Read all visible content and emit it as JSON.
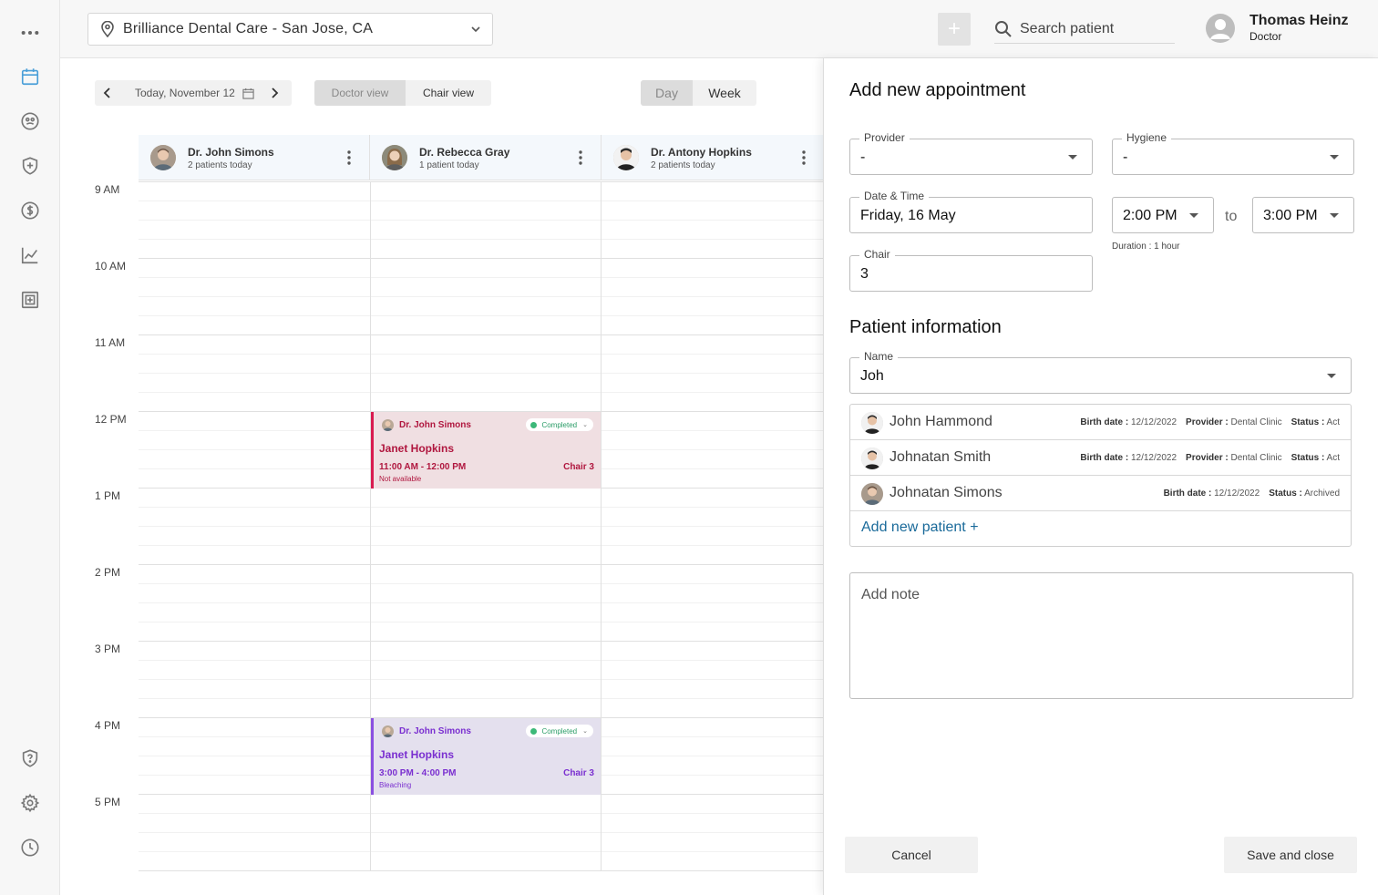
{
  "topbar": {
    "location": "Brilliance Dental Care - San Jose, CA",
    "search_placeholder": "Search patient",
    "user_name": "Thomas Heinz",
    "user_role": "Doctor"
  },
  "toolbar": {
    "date_label": "Today, November 12",
    "doctor_view": "Doctor view",
    "chair_view": "Chair view",
    "day": "Day",
    "week": "Week"
  },
  "providers": [
    {
      "name": "Dr. John Simons",
      "sub": "2 patients today"
    },
    {
      "name": "Dr. Rebecca Gray",
      "sub": "1 patient today"
    },
    {
      "name": "Dr. Antony Hopkins",
      "sub": "2 patients today"
    }
  ],
  "hours": [
    "9 AM",
    "10 AM",
    "11 AM",
    "12 PM",
    "1 PM",
    "2 PM",
    "3 PM",
    "4 PM",
    "5 PM"
  ],
  "appointments": [
    {
      "doctor": "Dr. John Simons",
      "status": "Completed",
      "patient": "Janet Hopkins",
      "time": "11:00 AM - 12:00 PM",
      "chair": "Chair 3",
      "note": "Not available",
      "accent": "#d81b50",
      "bg": "#f0dfe2",
      "text": "#b0173f"
    },
    {
      "doctor": "Dr. John Simons",
      "status": "Completed",
      "patient": "Janet Hopkins",
      "time": "3:00 PM - 4:00 PM",
      "chair": "Chair 3",
      "note": "Bleaching",
      "accent": "#8a4fe0",
      "bg": "#e4e0ee",
      "text": "#7a2fd0"
    }
  ],
  "panel": {
    "title": "Add new appointment",
    "provider_label": "Provider",
    "provider_value": "-",
    "hygiene_label": "Hygiene",
    "hygiene_value": "-",
    "datetime_label": "Date & Time",
    "datetime_value": "Friday, 16 May",
    "time_from": "2:00 PM",
    "to": "to",
    "time_to": "3:00 PM",
    "duration": "Duration : 1 hour",
    "chair_label": "Chair",
    "chair_value": "3",
    "patient_title": "Patient information",
    "name_label": "Name",
    "name_value": "Joh",
    "patients": [
      {
        "name": "John Hammond",
        "birth_label": "Birth date :",
        "birth": "12/12/2022",
        "provider_label": "Provider :",
        "provider": "Dental Clinic",
        "status_label": "Status :",
        "status": "Act"
      },
      {
        "name": "Johnatan Smith",
        "birth_label": "Birth date :",
        "birth": "12/12/2022",
        "provider_label": "Provider :",
        "provider": "Dental Clinic",
        "status_label": "Status :",
        "status": "Act"
      },
      {
        "name": "Johnatan Simons",
        "birth_label": "Birth date :",
        "birth": "12/12/2022",
        "status_label": "Status :",
        "status": "Archived"
      }
    ],
    "add_patient": "Add new patient +",
    "note_placeholder": "Add note",
    "cancel": "Cancel",
    "save": "Save and close"
  },
  "icons": [
    "more-icon",
    "calendar-icon",
    "patients-icon",
    "insurance-icon",
    "billing-icon",
    "reports-icon",
    "clinic-icon",
    "help-icon",
    "settings-icon",
    "history-icon"
  ]
}
